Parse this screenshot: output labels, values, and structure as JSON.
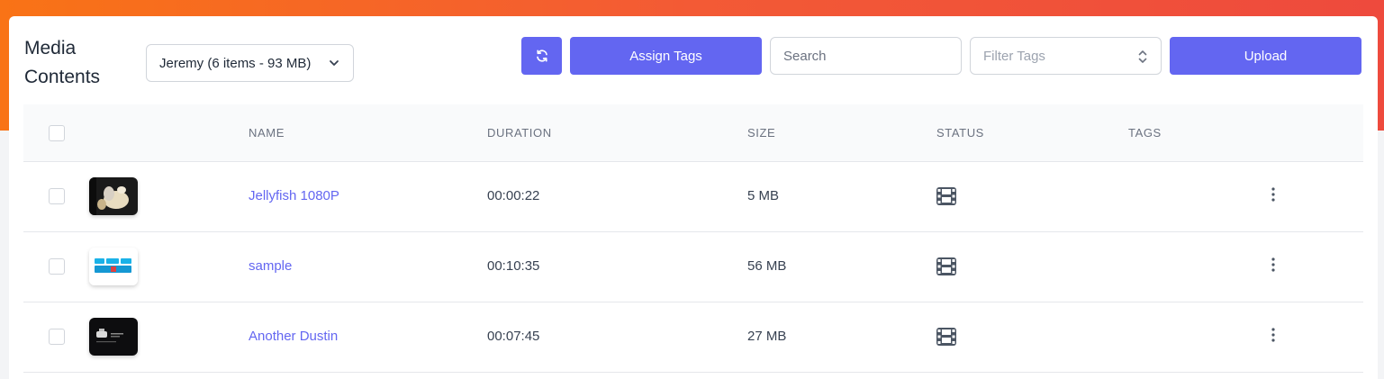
{
  "page": {
    "title": "Media Contents"
  },
  "folder_select": {
    "value": "Jeremy (6 items - 93 MB)"
  },
  "toolbar": {
    "refresh_icon": "refresh-icon",
    "assign_tags_label": "Assign Tags",
    "search_placeholder": "Search",
    "filter_tags_placeholder": "Filter Tags",
    "upload_label": "Upload"
  },
  "colors": {
    "accent": "#6366f1",
    "banner_start": "#f97316",
    "banner_end": "#ee4a3d"
  },
  "table": {
    "columns": [
      "NAME",
      "DURATION",
      "SIZE",
      "STATUS",
      "TAGS"
    ],
    "rows": [
      {
        "name": "Jellyfish 1080P",
        "duration": "00:00:22",
        "size": "5 MB",
        "status_icon": "film-icon",
        "tags": ""
      },
      {
        "name": "sample",
        "duration": "00:10:35",
        "size": "56 MB",
        "status_icon": "film-icon",
        "tags": ""
      },
      {
        "name": "Another Dustin",
        "duration": "00:07:45",
        "size": "27 MB",
        "status_icon": "film-icon",
        "tags": ""
      }
    ]
  }
}
